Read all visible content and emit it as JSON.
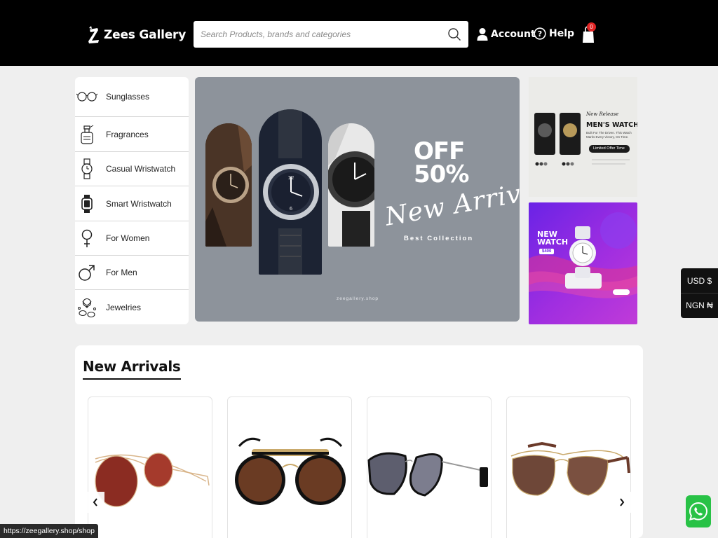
{
  "header": {
    "logo_text": "Zees Gallery",
    "search_placeholder": "Search Products, brands and categories",
    "account_label": "Account",
    "help_label": "Help",
    "cart_count": "0"
  },
  "categories": [
    {
      "label": "Sunglasses",
      "icon": "glasses-icon"
    },
    {
      "label": "Fragrances",
      "icon": "perfume-icon"
    },
    {
      "label": "Casual Wristwatch",
      "icon": "wristwatch-icon"
    },
    {
      "label": "Smart Wristwatch",
      "icon": "smartwatch-icon"
    },
    {
      "label": "For Women",
      "icon": "female-symbol-icon"
    },
    {
      "label": "For Men",
      "icon": "male-symbol-icon"
    },
    {
      "label": "Jewelries",
      "icon": "jewelry-icon"
    }
  ],
  "hero": {
    "off_line1": "OFF",
    "off_line2": "50%",
    "script_text": "New Arrival",
    "best_collection": "Best Collection",
    "domain": "zeegallery.shop"
  },
  "promo1": {
    "new_release": "New Release",
    "title": "MEN'S WATCH",
    "tagline": "Built For The Driven. This Watch Marks Every Victory, On Time.",
    "limited": "Limited Offer Time"
  },
  "promo2": {
    "title_line1": "NEW",
    "title_line2": "WATCH",
    "price": "$400"
  },
  "currency": {
    "usd": "USD $",
    "ngn": "NGN ₦"
  },
  "arrivals": {
    "title": "New Arrivals",
    "products": [
      {
        "name": "Round metal sunglasses red lens"
      },
      {
        "name": "Round brow-bar sunglasses brown lens"
      },
      {
        "name": "Cat-eye sunglasses grey lens"
      },
      {
        "name": "Square aviator sunglasses brown lens"
      }
    ]
  },
  "status_url": "https://zeegallery.shop/shop",
  "colors": {
    "header_bg": "#000000",
    "page_bg": "#efefef",
    "hero_bg": "#8d939b",
    "badge": "#e02424",
    "whatsapp": "#28c246"
  }
}
